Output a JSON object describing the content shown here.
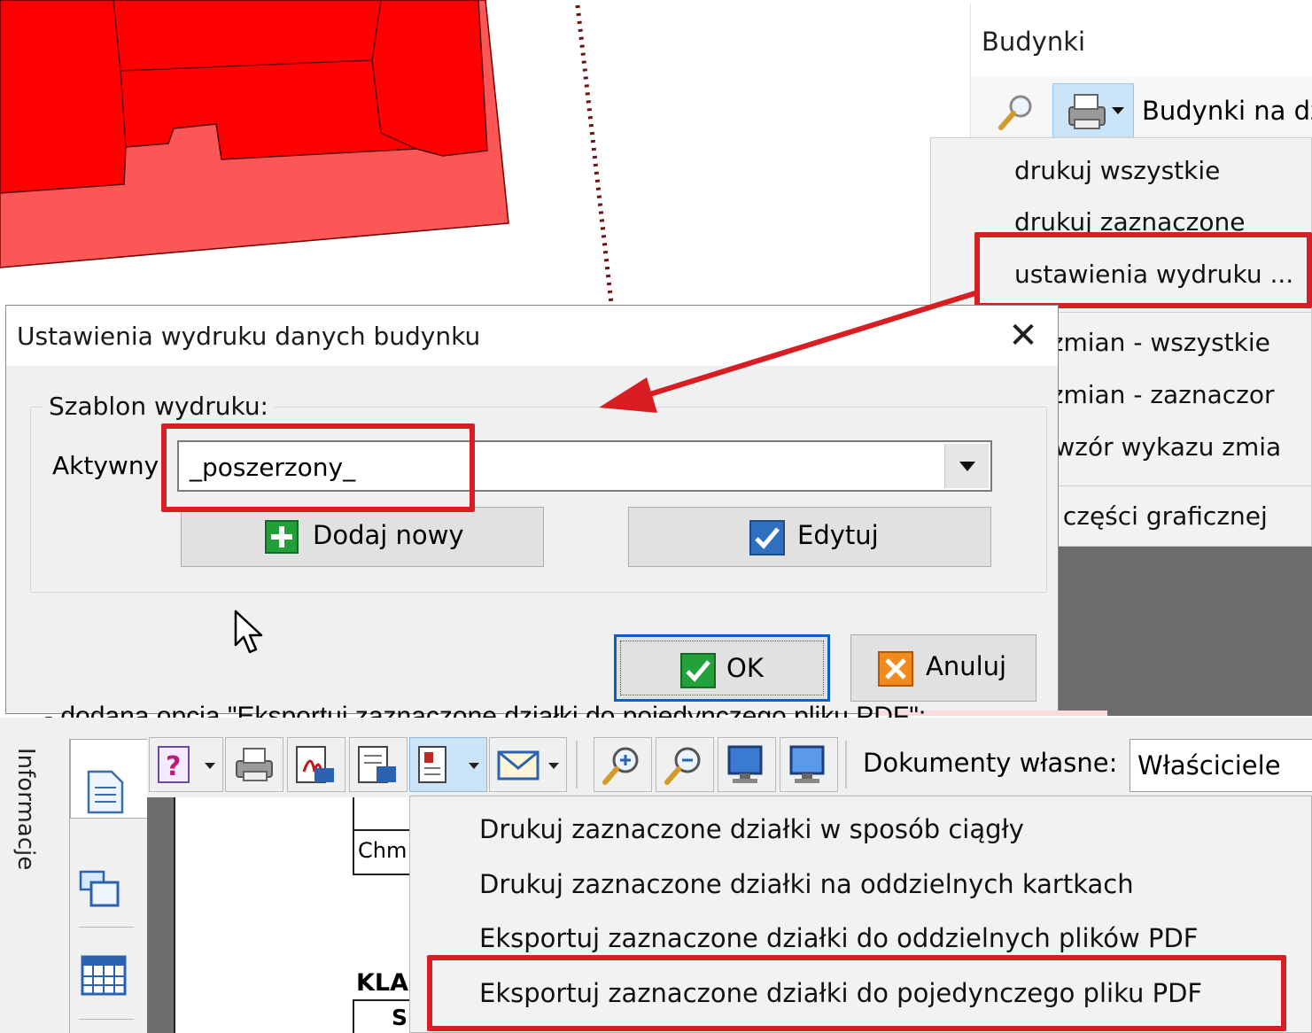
{
  "budynki_panel": {
    "title": "Budynki",
    "report_label": "Budynki na dz"
  },
  "print_menu": {
    "items": [
      "drukuj wszystkie",
      "drukuj zaznaczone",
      "ustawienia wydruku ...",
      "az zmian - wszystkie",
      "az zmian - zaznaczor",
      "tuj wzór wykazu zmia",
      "is z części graficznej"
    ]
  },
  "dialog": {
    "title": "Ustawienia wydruku danych budynku",
    "close_glyph": "✕",
    "group_label": "Szablon wydruku:",
    "active_label": "Aktywny",
    "active_value": "_poszerzony_",
    "add_button": "Dodaj nowy",
    "edit_button": "Edytuj",
    "ok_button": "OK",
    "cancel_button": "Anuluj"
  },
  "caption_line": "-   dodana opcja \"Eksportuj zaznaczone działki do pojedynczego pliku PDF\";",
  "bottom_panel": {
    "vertical_tab": "Informacje",
    "documents_label": "Dokumenty własne:",
    "owner_value": "Właściciele",
    "doc_fragments": {
      "chm": "Chm",
      "kla": "KLA",
      "sp": "Sp"
    },
    "export_menu": {
      "items": [
        "Drukuj zaznaczone działki w sposób ciągły",
        "Drukuj zaznaczone działki na oddzielnych kartkach",
        "Eksportuj zaznaczone działki do oddzielnych plików PDF",
        "Eksportuj zaznaczone działki do pojedynczego pliku PDF"
      ]
    }
  },
  "colors": {
    "highlight_red": "#d81d23",
    "building_red": "#ff0000",
    "building_light_red": "#fb5757",
    "menu_bg": "#f2f2f2",
    "pressed_button": "#cce4f7"
  },
  "icons": {
    "search": "magnifier-icon",
    "print": "printer-icon",
    "add": "green-plus-icon",
    "edit": "blue-check-icon",
    "ok": "green-check-icon",
    "cancel": "orange-x-icon"
  }
}
